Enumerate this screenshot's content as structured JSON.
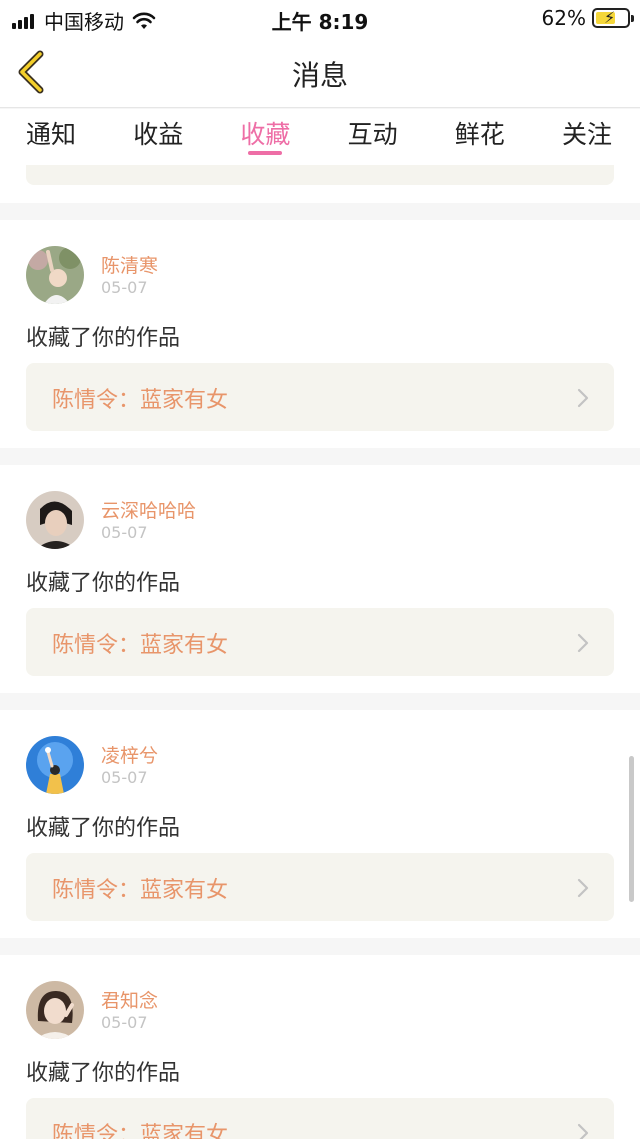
{
  "status_bar": {
    "carrier": "中国移动",
    "time": "上午 8:19",
    "battery_percent": "62%",
    "battery_level": 0.62
  },
  "nav": {
    "title": "消息",
    "back_icon": "chevron-left-icon"
  },
  "tabs": [
    {
      "label": "通知",
      "active": false
    },
    {
      "label": "收益",
      "active": false
    },
    {
      "label": "收藏",
      "active": true
    },
    {
      "label": "互动",
      "active": false
    },
    {
      "label": "鲜花",
      "active": false
    },
    {
      "label": "关注",
      "active": false
    }
  ],
  "colors": {
    "accent": "#ee6ea6",
    "name": "#e8956a",
    "link_bg": "#f5f4ee"
  },
  "messages": [
    {
      "user": "陈清寒",
      "date": "05-07",
      "action": "收藏了你的作品",
      "work": "陈情令：蓝家有女"
    },
    {
      "user": "云深哈哈哈",
      "date": "05-07",
      "action": "收藏了你的作品",
      "work": "陈情令：蓝家有女"
    },
    {
      "user": "凌梓兮",
      "date": "05-07",
      "action": "收藏了你的作品",
      "work": "陈情令：蓝家有女"
    },
    {
      "user": "君知念",
      "date": "05-07",
      "action": "收藏了你的作品",
      "work": "陈情令：蓝家有女"
    }
  ]
}
